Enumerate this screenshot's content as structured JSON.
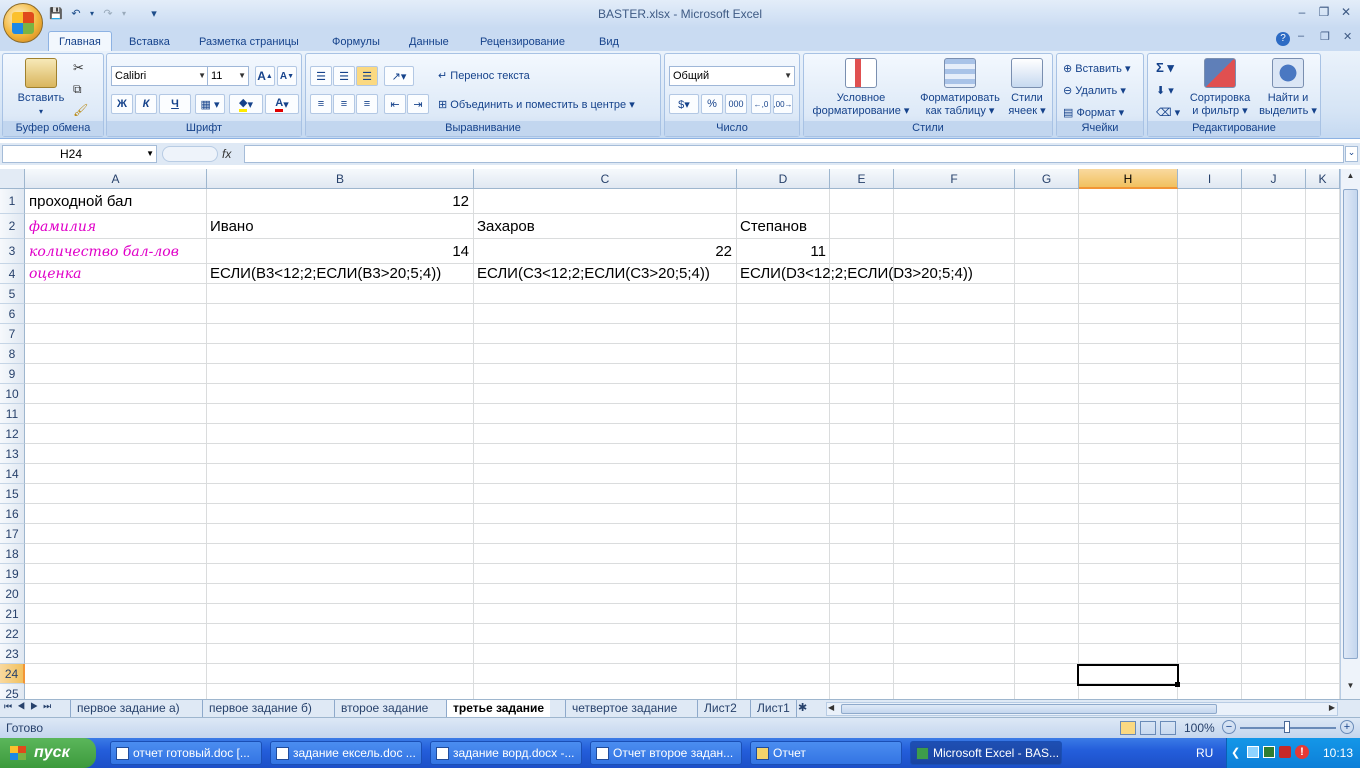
{
  "window": {
    "title": "BASTER.xlsx - Microsoft Excel"
  },
  "qat": {
    "save": "💾",
    "undo": "↶",
    "redo": "↷",
    "more": "▾"
  },
  "ribbon": {
    "tabs": [
      "Главная",
      "Вставка",
      "Разметка страницы",
      "Формулы",
      "Данные",
      "Рецензирование",
      "Вид"
    ],
    "groups": {
      "clipboard": {
        "label": "Буфер обмена",
        "paste": "Вставить"
      },
      "font": {
        "label": "Шрифт",
        "family": "Calibri",
        "size": "11",
        "bold": "Ж",
        "italic": "К",
        "underline": "Ч"
      },
      "alignment": {
        "label": "Выравнивание",
        "wrap": "Перенос текста",
        "merge": "Объединить и поместить в центре"
      },
      "number": {
        "label": "Число",
        "format": "Общий",
        "percent": "%",
        "thousands": "000"
      },
      "styles": {
        "label": "Стили",
        "cond_line1": "Условное",
        "cond_line2": "форматирование",
        "table_line1": "Форматировать",
        "table_line2": "как таблицу",
        "cell_line1": "Стили",
        "cell_line2": "ячеек"
      },
      "cells": {
        "label": "Ячейки",
        "insert": "Вставить",
        "delete": "Удалить",
        "format": "Формат"
      },
      "editing": {
        "label": "Редактирование",
        "sort_line1": "Сортировка",
        "sort_line2": "и фильтр",
        "find_line1": "Найти и",
        "find_line2": "выделить"
      }
    }
  },
  "formula_bar": {
    "name_box": "H24",
    "fx": "fx",
    "formula": ""
  },
  "grid": {
    "columns": [
      "A",
      "B",
      "C",
      "D",
      "E",
      "F",
      "G",
      "H",
      "I",
      "J",
      "K"
    ],
    "selected_column": "H",
    "rows": [
      "1",
      "2",
      "3",
      "4",
      "5",
      "6",
      "7",
      "8",
      "9",
      "10",
      "11",
      "12",
      "13",
      "14",
      "15",
      "16",
      "17",
      "18",
      "19",
      "20",
      "21",
      "22",
      "23",
      "24",
      "25"
    ],
    "cells": {
      "A1": "проходной бал",
      "B1": "12",
      "A2": "фамилия",
      "B2": "Ивано",
      "C2": "Захаров",
      "D2": "Степанов",
      "A3": "количество бал-лов",
      "B3": "14",
      "C3": "22",
      "D3": "11",
      "A4": "оценка",
      "B4": "ЕСЛИ(B3<12;2;ЕСЛИ(B3>20;5;4))",
      "C4": "ЕСЛИ(C3<12;2;ЕСЛИ(C3>20;5;4))",
      "D4": "ЕСЛИ(D3<12;2;ЕСЛИ(D3>20;5;4))"
    },
    "selected_cell": "H24"
  },
  "sheets": {
    "tabs": [
      "первое задание а)",
      "первое задание б)",
      "второе задание",
      "третье задание",
      "четвертое задание",
      "Лист2",
      "Лист1"
    ],
    "active": "третье задание"
  },
  "status": {
    "ready": "Готово",
    "zoom": "100%"
  },
  "taskbar": {
    "start": "пуск",
    "items": [
      "отчет готовый.doc [...",
      "задание ексель.doc ...",
      "задание ворд.docx -...",
      "Отчет второе задан...",
      "Отчет",
      "Microsoft Excel - BAS..."
    ],
    "lang": "RU",
    "clock": "10:13"
  }
}
